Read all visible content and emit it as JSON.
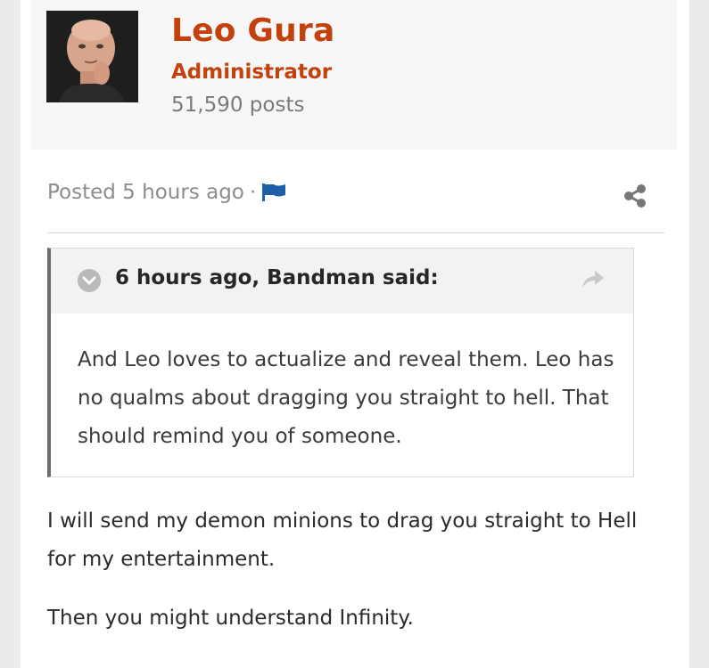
{
  "author": {
    "name": "Leo Gura",
    "role": "Administrator",
    "posts": "51,590 posts",
    "avatar_icon": "avatar-photo"
  },
  "post_meta": {
    "posted": "Posted 5 hours ago",
    "separator": "·",
    "flag_icon": "flag-icon",
    "share_icon": "share-icon"
  },
  "quote": {
    "author": "6 hours ago, Bandman said:",
    "body": "And Leo loves to actualize and reveal them. Leo has no qualms about dragging you straight to hell. That should remind you of someone.",
    "toggle_icon": "chevron-down-icon",
    "jump_icon": "share-arrow-icon"
  },
  "post": {
    "paragraphs": [
      "I will send my demon minions to drag you straight to Hell for my entertainment.",
      "Then you might understand Infinity."
    ]
  },
  "colors": {
    "accent": "#c2410c",
    "muted": "#8c8c8c",
    "flag": "#1f5fa8"
  }
}
